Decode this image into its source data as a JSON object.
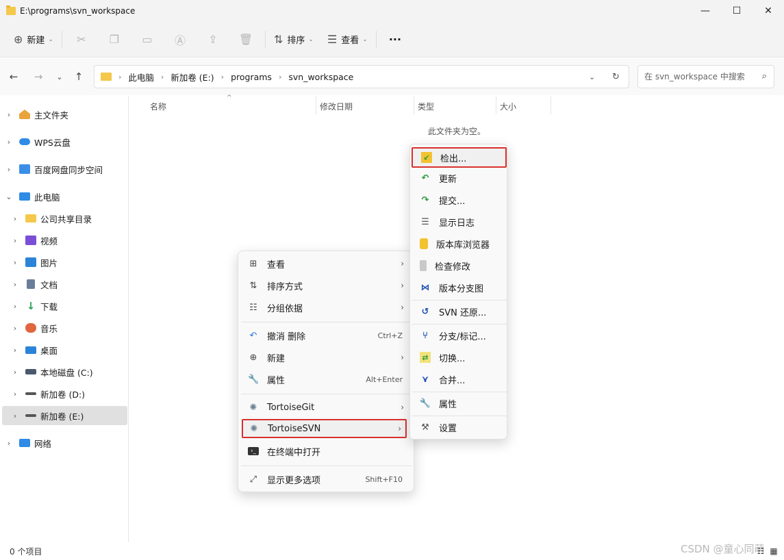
{
  "window": {
    "title": "E:\\programs\\svn_workspace",
    "min": "—",
    "max": "☐",
    "close": "✕"
  },
  "toolbar": {
    "new_label": "新建",
    "sort_label": "排序",
    "view_label": "查看",
    "more_label": "···"
  },
  "address": {
    "crumbs": [
      "此电脑",
      "新加卷 (E:)",
      "programs",
      "svn_workspace"
    ],
    "search_placeholder": "在 svn_workspace 中搜索"
  },
  "sidebar": {
    "items": [
      {
        "label": "主文件夹",
        "icon": "home-icon",
        "color": "#e8a33d"
      },
      {
        "label": "WPS云盘",
        "icon": "cloud-icon",
        "color": "#2f8be6"
      },
      {
        "label": "百度网盘同步空间",
        "icon": "baidu-sync-icon",
        "color": "#3b8ee8"
      },
      {
        "label": "此电脑",
        "icon": "computer-icon",
        "color": "#2f8be6"
      },
      {
        "label": "公司共享目录",
        "icon": "folder-icon",
        "color": "#f4c84a"
      },
      {
        "label": "视频",
        "icon": "video-icon",
        "color": "#7a4fd6"
      },
      {
        "label": "图片",
        "icon": "picture-icon",
        "color": "#2c84d8"
      },
      {
        "label": "文档",
        "icon": "document-icon",
        "color": "#6b7d99"
      },
      {
        "label": "下载",
        "icon": "download-icon",
        "color": "#2aa05a"
      },
      {
        "label": "音乐",
        "icon": "music-icon",
        "color": "#e0663e"
      },
      {
        "label": "桌面",
        "icon": "desktop-icon",
        "color": "#2c84d8"
      },
      {
        "label": "本地磁盘 (C:)",
        "icon": "drive-c-icon",
        "color": "#4a5a6e"
      },
      {
        "label": "新加卷 (D:)",
        "icon": "drive-icon",
        "color": "#555555"
      },
      {
        "label": "新加卷 (E:)",
        "icon": "drive-icon",
        "color": "#555555"
      },
      {
        "label": "网络",
        "icon": "network-icon",
        "color": "#2f8be6"
      }
    ]
  },
  "columns": [
    "名称",
    "修改日期",
    "类型",
    "大小"
  ],
  "empty_message": "此文件夹为空。",
  "status": {
    "count": "0 个项目"
  },
  "watermark": "CSDN @童心同萌",
  "context_menu": {
    "items": [
      {
        "label": "查看",
        "icon": "grid-icon"
      },
      {
        "label": "排序方式",
        "icon": "sort-icon"
      },
      {
        "label": "分组依据",
        "icon": "group-icon"
      },
      {
        "label": "撤消 删除",
        "icon": "undo-icon",
        "shortcut": "Ctrl+Z"
      },
      {
        "label": "新建",
        "icon": "new-icon"
      },
      {
        "label": "属性",
        "icon": "wrench-icon",
        "shortcut": "Alt+Enter"
      },
      {
        "label": "TortoiseGit",
        "icon": "tortoise-icon"
      },
      {
        "label": "TortoiseSVN",
        "icon": "tortoise-icon"
      },
      {
        "label": "在终端中打开",
        "icon": "terminal-icon"
      },
      {
        "label": "显示更多选项",
        "icon": "expand-icon",
        "shortcut": "Shift+F10"
      }
    ]
  },
  "svn_menu": {
    "items": [
      {
        "label": "检出...",
        "icon": "checkout-icon"
      },
      {
        "label": "更新",
        "icon": "update-icon"
      },
      {
        "label": "提交...",
        "icon": "commit-icon"
      },
      {
        "label": "显示日志",
        "icon": "log-icon"
      },
      {
        "label": "版本库浏览器",
        "icon": "repo-browser-icon"
      },
      {
        "label": "检查修改",
        "icon": "check-modifications-icon"
      },
      {
        "label": "版本分支图",
        "icon": "revision-graph-icon"
      },
      {
        "label": "SVN 还原...",
        "icon": "revert-icon"
      },
      {
        "label": "分支/标记...",
        "icon": "branch-tag-icon"
      },
      {
        "label": "切换...",
        "icon": "switch-icon"
      },
      {
        "label": "合并...",
        "icon": "merge-icon"
      },
      {
        "label": "属性",
        "icon": "properties-icon"
      },
      {
        "label": "设置",
        "icon": "settings-icon"
      }
    ]
  }
}
